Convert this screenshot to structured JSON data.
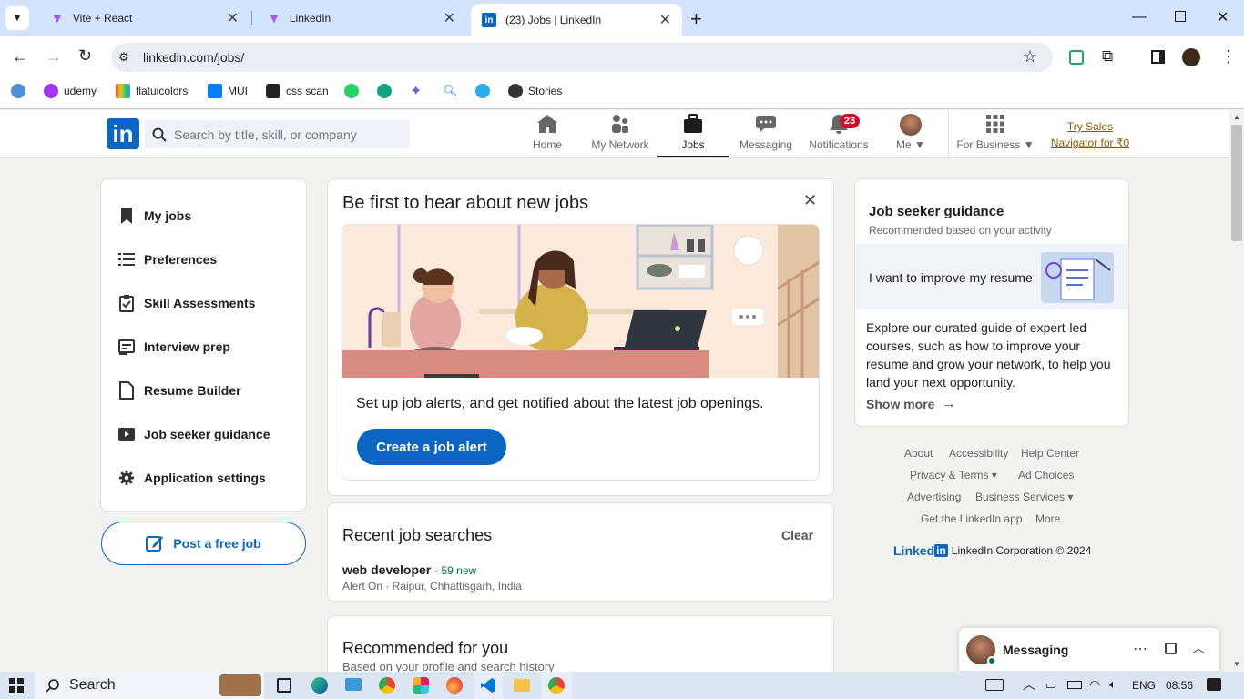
{
  "browser": {
    "tabs": [
      {
        "title": "Vite + React",
        "active": false
      },
      {
        "title": "LinkedIn",
        "active": false
      },
      {
        "title": "(23) Jobs | LinkedIn",
        "active": true
      }
    ],
    "url": "linkedin.com/jobs/",
    "bookmarks": [
      {
        "label": "",
        "icon": "blue-circle-icon"
      },
      {
        "label": "udemy",
        "icon": "udemy-icon"
      },
      {
        "label": "flatuicolors",
        "icon": "flatuicolors-icon"
      },
      {
        "label": "MUI",
        "icon": "mui-icon"
      },
      {
        "label": "css scan",
        "icon": "css-scan-icon"
      },
      {
        "label": "",
        "icon": "whatsapp-icon"
      },
      {
        "label": "",
        "icon": "chatgpt-icon"
      },
      {
        "label": "",
        "icon": "gemini-icon"
      },
      {
        "label": "",
        "icon": "search-lens-icon"
      },
      {
        "label": "",
        "icon": "telegram-icon"
      },
      {
        "label": "Stories",
        "icon": "stories-icon"
      }
    ]
  },
  "nav": {
    "logo": "in",
    "search_placeholder": "Search by title, skill, or company",
    "items": [
      {
        "label": "Home",
        "icon": "home-icon"
      },
      {
        "label": "My Network",
        "icon": "network-icon"
      },
      {
        "label": "Jobs",
        "icon": "briefcase-icon",
        "active": true
      },
      {
        "label": "Messaging",
        "icon": "messaging-icon"
      },
      {
        "label": "Notifications",
        "icon": "bell-icon"
      },
      {
        "label": "Me ▼",
        "icon": "avatar"
      },
      {
        "label": "For Business ▼",
        "icon": "grid-icon"
      }
    ],
    "notifications_count": "23",
    "premium_line1": "Try Sales",
    "premium_line2": "Navigator for ₹0"
  },
  "left_menu": {
    "items": [
      {
        "label": "My jobs",
        "icon": "bookmark-icon"
      },
      {
        "label": "Preferences",
        "icon": "list-icon"
      },
      {
        "label": "Skill Assessments",
        "icon": "clipboard-check-icon"
      },
      {
        "label": "Interview prep",
        "icon": "interview-icon"
      },
      {
        "label": "Resume Builder",
        "icon": "document-icon"
      },
      {
        "label": "Job seeker guidance",
        "icon": "video-icon"
      },
      {
        "label": "Application settings",
        "icon": "gear-icon"
      }
    ],
    "post_job": "Post a free job"
  },
  "alert_card": {
    "title": "Be first to hear about new jobs",
    "text": "Set up job alerts, and get notified about the latest job openings.",
    "button": "Create a job alert"
  },
  "recent_searches": {
    "title": "Recent job searches",
    "clear": "Clear",
    "items": [
      {
        "query": "web developer",
        "new_count": "· 59 new",
        "meta": "Alert On · Raipur, Chhattisgarh, India"
      }
    ]
  },
  "recommended": {
    "title": "Recommended for you",
    "subtitle": "Based on your profile and search history"
  },
  "guidance": {
    "title": "Job seeker guidance",
    "subtitle": "Recommended based on your activity",
    "banner": "I want to improve my resume",
    "body": "Explore our curated guide of expert-led courses, such as how to improve your resume and grow your network, to help you land your next opportunity.",
    "show_more": "Show more"
  },
  "footer": {
    "row1": [
      "About",
      "Accessibility",
      "Help Center"
    ],
    "row2": [
      "Privacy & Terms ▾",
      "Ad Choices"
    ],
    "row3": [
      "Advertising",
      "Business Services ▾"
    ],
    "row4": [
      "Get the LinkedIn app",
      "More"
    ],
    "brand": "Linked",
    "brand_in": "in",
    "copyright": "LinkedIn Corporation © 2024"
  },
  "messaging": {
    "label": "Messaging"
  },
  "taskbar": {
    "search": "Search",
    "lang": "ENG",
    "time": "08:56"
  }
}
